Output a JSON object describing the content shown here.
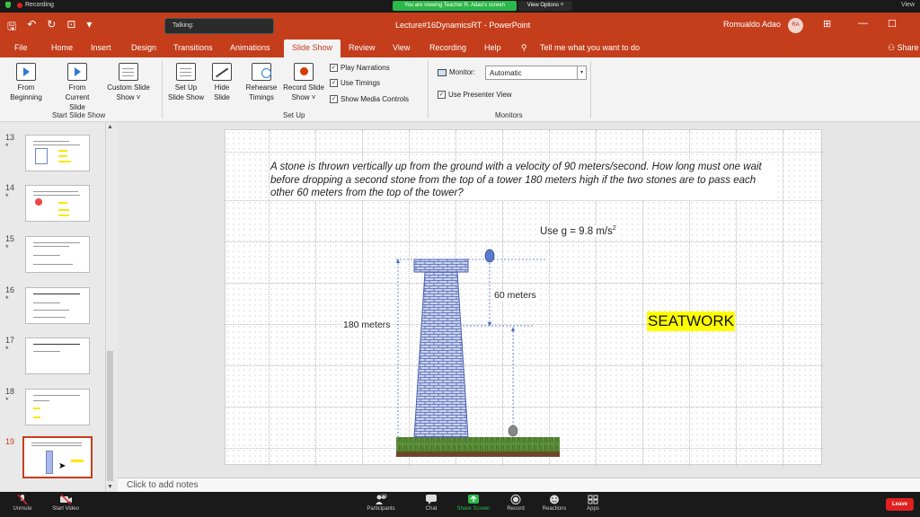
{
  "zoom": {
    "recording": "Recording",
    "viewing_banner": "You are viewing Teacher R. Adao's screen",
    "view_options": "View Options",
    "view_right": "View",
    "bottom": {
      "unmute": "Unmute",
      "start_video": "Start Video",
      "participants": "Participants",
      "participants_count": "29",
      "chat": "Chat",
      "share_screen": "Share Screen",
      "record": "Record",
      "reactions": "Reactions",
      "apps": "Apps",
      "leave": "Leave"
    }
  },
  "titlebar": {
    "talking": "Talking:",
    "document_title": "Lecture#16DynamicsRT  -  PowerPoint",
    "user_name": "Romualdo Adao",
    "avatar_initials": "RA"
  },
  "tabs": [
    "File",
    "Home",
    "Insert",
    "Design",
    "Transitions",
    "Animations",
    "Slide Show",
    "Review",
    "View",
    "Recording",
    "Help"
  ],
  "active_tab": "Slide Show",
  "tell_me": "Tell me what you want to do",
  "share": "Share",
  "ribbon": {
    "from_beginning": [
      "From",
      "Beginning"
    ],
    "from_current": [
      "From",
      "Current Slide"
    ],
    "custom_slide": [
      "Custom Slide",
      "Show ˅"
    ],
    "start_group": "Start Slide Show",
    "set_up_show": [
      "Set Up",
      "Slide Show"
    ],
    "hide_slide": [
      "Hide",
      "Slide"
    ],
    "rehearse": [
      "Rehearse",
      "Timings"
    ],
    "record_slide": [
      "Record Slide",
      "Show ˅"
    ],
    "play_narrations": "Play Narrations",
    "use_timings": "Use Timings",
    "show_media_controls": "Show Media Controls",
    "setup_group": "Set Up",
    "monitor_label": "Monitor:",
    "monitor_value": "Automatic",
    "use_presenter_view": "Use Presenter View",
    "monitors_group": "Monitors"
  },
  "slides": {
    "numbers": [
      "13",
      "14",
      "15",
      "16",
      "17",
      "18",
      "19"
    ],
    "star": "*",
    "selected": "19"
  },
  "slide": {
    "problem_text": "A stone is thrown vertically up from the ground with a velocity of 90 meters/second.  How long must one wait before dropping a second stone from the top of a tower 180 meters high if the two stones are to pass each other 60 meters from the top of the tower?",
    "gravity": "Use g = 9.8 m/s",
    "gravity_exp": "2",
    "label_180": "180 meters",
    "label_60": "60 meters",
    "seatwork": "SEATWORK"
  },
  "notes_placeholder": "Click to add notes",
  "colors": {
    "powerpoint_red": "#c43e1c",
    "zoom_green": "#2db84b",
    "highlight_yellow": "#ffff00",
    "tower_blue": "#6f86c9"
  }
}
